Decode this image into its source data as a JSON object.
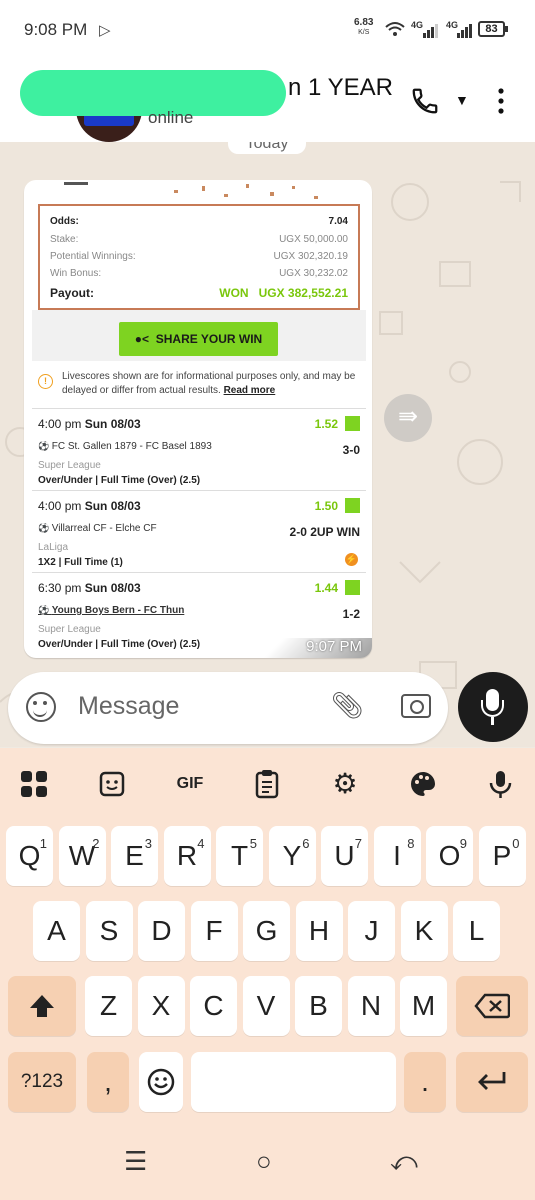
{
  "status_bar": {
    "time": "9:08 PM",
    "net_speed": "6.83",
    "net_speed_unit": "K/S",
    "network_1": "4G",
    "network_2": "4G",
    "battery": "83"
  },
  "header": {
    "title": "n 1 YEAR",
    "subtitle": "online"
  },
  "chat": {
    "date_divider": "Today",
    "bet_receipt": {
      "odds_label": "Odds:",
      "odds_value": "7.04",
      "stake_label": "Stake:",
      "stake_value": "UGX 50,000.00",
      "potential_label": "Potential Winnings:",
      "potential_value": "UGX 302,320.19",
      "bonus_label": "Win Bonus:",
      "bonus_value": "UGX 30,232.02",
      "payout_label": "Payout:",
      "payout_status": "WON",
      "payout_value": "UGX 382,552.21"
    },
    "share_button": "SHARE YOUR WIN",
    "info_text": "Livescores shown are for informational purposes only, and may be delayed or differ from actual results.",
    "info_link": "Read more",
    "bets": [
      {
        "time": "4:00 pm",
        "date": "Sun 08/03",
        "odds": "1.52",
        "teams": "FC St. Gallen 1879 - FC Basel 1893",
        "score": "3-0",
        "league": "Super League",
        "market": "Over/Under | Full Time (Over) (2.5)"
      },
      {
        "time": "4:00 pm",
        "date": "Sun 08/03",
        "odds": "1.50",
        "teams": "Villarreal CF - Elche CF",
        "score": "2-0 2UP WIN",
        "league": "LaLiga",
        "market": "1X2 | Full Time (1)"
      },
      {
        "time": "6:30 pm",
        "date": "Sun 08/03",
        "odds": "1.44",
        "teams": "Young Boys Bern - FC Thun",
        "score": "1-2",
        "league": "Super League",
        "market": "Over/Under | Full Time (Over) (2.5)"
      }
    ],
    "message_time": "9:07 PM"
  },
  "composer": {
    "placeholder": "Message"
  },
  "keyboard": {
    "toolbar": [
      "apps",
      "sticker",
      "GIF",
      "clipboard",
      "settings",
      "theme",
      "voice"
    ],
    "gif_label": "GIF",
    "row1": [
      {
        "k": "Q",
        "n": "1"
      },
      {
        "k": "W",
        "n": "2"
      },
      {
        "k": "E",
        "n": "3"
      },
      {
        "k": "R",
        "n": "4"
      },
      {
        "k": "T",
        "n": "5"
      },
      {
        "k": "Y",
        "n": "6"
      },
      {
        "k": "U",
        "n": "7"
      },
      {
        "k": "I",
        "n": "8"
      },
      {
        "k": "O",
        "n": "9"
      },
      {
        "k": "P",
        "n": "0"
      }
    ],
    "row2": [
      "A",
      "S",
      "D",
      "F",
      "G",
      "H",
      "J",
      "K",
      "L"
    ],
    "row3": [
      "Z",
      "X",
      "C",
      "V",
      "B",
      "N",
      "M"
    ],
    "numbers_key": "?123",
    "comma_key": ",",
    "period_key": "."
  },
  "colors": {
    "accent_green": "#7ed321",
    "won_green": "#7ac70c",
    "keyboard_bg": "#fbe4d4",
    "receipt_border": "#c77a56"
  }
}
